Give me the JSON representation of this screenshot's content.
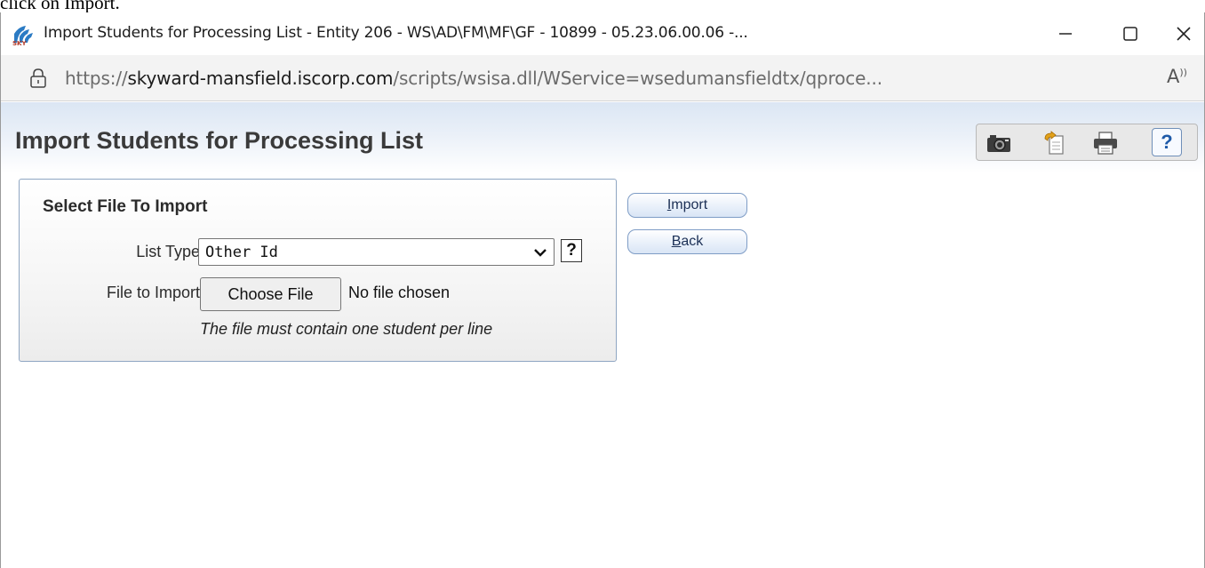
{
  "top_strip": {
    "text": "click on Import."
  },
  "window": {
    "title": "Import Students for Processing List - Entity 206 - WS\\AD\\FM\\MF\\GF - 10899 - 05.23.06.00.06 -...",
    "controls": {
      "minimize_icon": "minimize-icon",
      "maximize_icon": "maximize-icon",
      "close_icon": "close-icon"
    }
  },
  "address_bar": {
    "scheme": "https://",
    "host": "skyward-mansfield.iscorp.com",
    "path": "/scripts/wsisa.dll/WService=wsedumansfieldtx/qproce...",
    "read_aloud_label": "A"
  },
  "page": {
    "title": "Import Students for Processing List",
    "toolbar": [
      "camera-icon",
      "clipboard-icon",
      "print-icon",
      "help-icon"
    ],
    "help_label": "?"
  },
  "panel": {
    "title": "Select File To Import",
    "list_type_label": "List Type:",
    "list_type_value": "Other Id",
    "list_type_help": "?",
    "file_label": "File to Import:",
    "choose_file_label": "Choose File",
    "no_file_text": "No file chosen",
    "hint": "The file must contain one student per line"
  },
  "buttons": {
    "import_access": "I",
    "import_rest": "mport",
    "back_access": "B",
    "back_rest": "ack"
  },
  "colors": {
    "header_gradient_top": "#dbe6f4",
    "panel_border": "#8fa6c2",
    "button_text": "#1b2f55",
    "help_blue": "#1f5aa8"
  }
}
